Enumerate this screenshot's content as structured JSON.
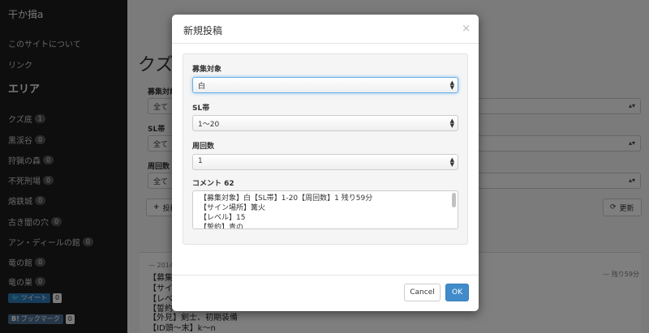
{
  "sidebar": {
    "brand": "干か揖a",
    "links": [
      "このサイトについて",
      "リンク"
    ],
    "heading": "エリア",
    "areas": [
      {
        "label": "クズ底",
        "count": "1"
      },
      {
        "label": "黒渓谷",
        "count": "0"
      },
      {
        "label": "狩猟の森",
        "count": "0"
      },
      {
        "label": "不死刑場",
        "count": "0"
      },
      {
        "label": "熔鉄城",
        "count": "0"
      },
      {
        "label": "古き闇の穴",
        "count": "0"
      },
      {
        "label": "アン・ディールの館",
        "count": "0"
      },
      {
        "label": "竜の館",
        "count": "0"
      },
      {
        "label": "竜の巣",
        "count": "0"
      }
    ],
    "tweet": {
      "label": "ツイート",
      "count": "0"
    },
    "bookmark": {
      "label": "ブックマーク",
      "count": "0"
    }
  },
  "background": {
    "title": "クズ底",
    "labels": [
      "募集対象",
      "SL帯",
      "周回数"
    ],
    "select_value": "全て",
    "post_button": "投稿",
    "refresh_button": "更新",
    "post_meta": "— 2014",
    "post_right": "— 残り59分",
    "post_lines": [
      "【募集",
      "【サイ",
      "【レベ",
      "【誓約",
      "【外見】剣士、初期装備",
      "【ID頭〜末】k〜n"
    ]
  },
  "modal": {
    "title": "新規投稿",
    "close": "×",
    "fields": [
      {
        "label": "募集対象",
        "value": "白"
      },
      {
        "label": "SL帯",
        "value": "1〜20"
      },
      {
        "label": "周回数",
        "value": "1"
      }
    ],
    "comment_label": "コメント 62",
    "comment_lines": [
      "【募集対象】白【SL帯】1-20【周回数】1 残り59分",
      "【サイン場所】篝火",
      "【レベル】15",
      "【誓約】青の"
    ],
    "cancel": "Cancel",
    "ok": "OK"
  }
}
